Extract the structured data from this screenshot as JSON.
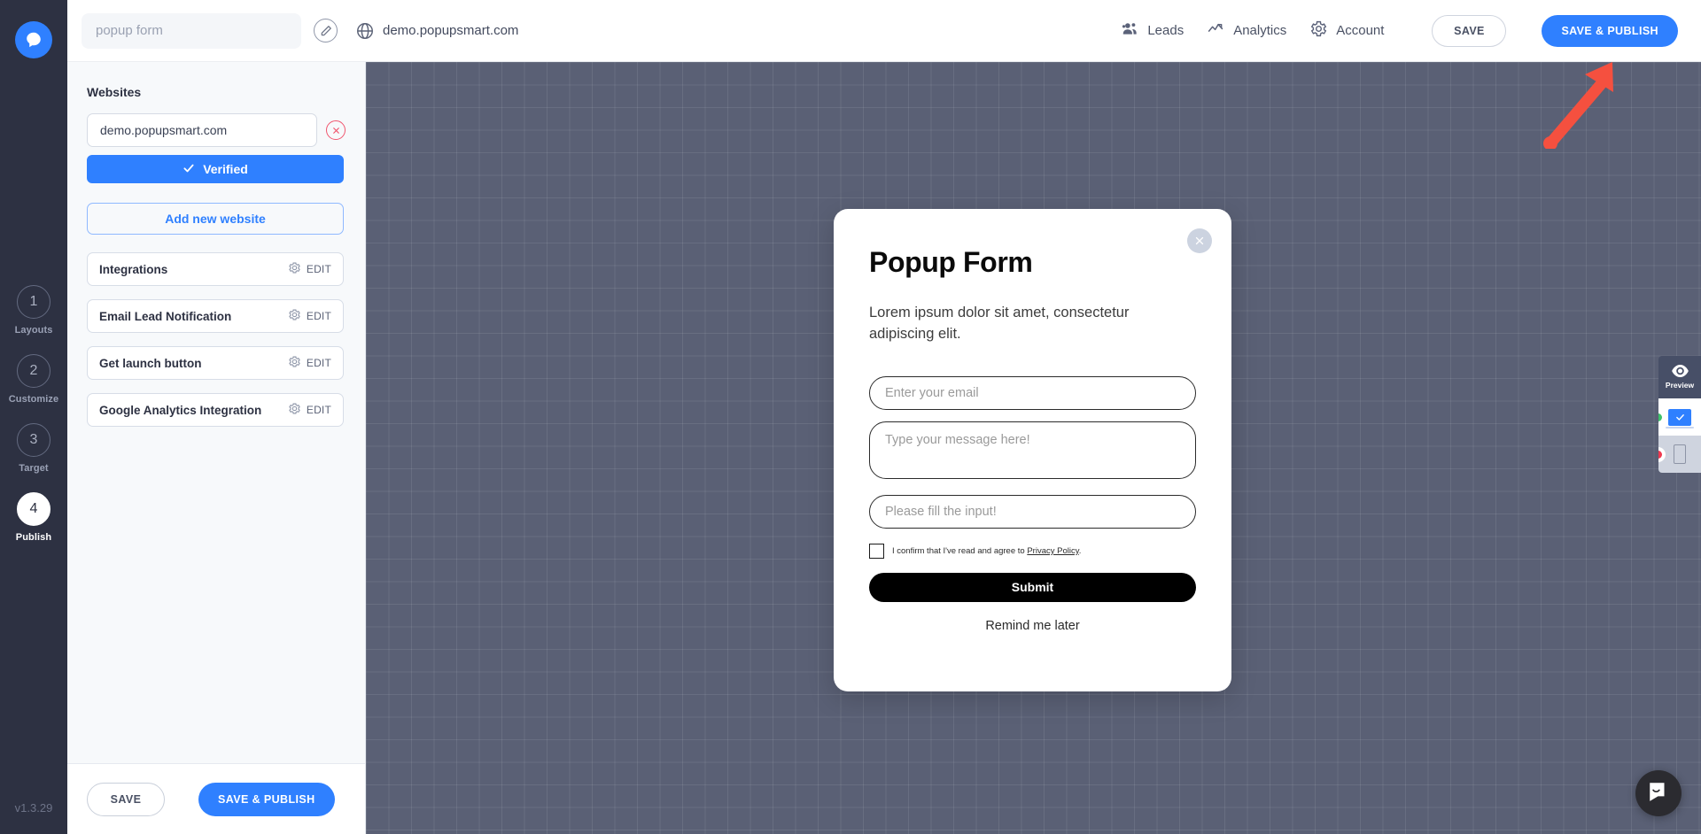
{
  "brand": {
    "logo_icon": "popupsmart-logo-icon",
    "version": "v1.3.29"
  },
  "topbar": {
    "campaign_name_placeholder": "popup form",
    "campaign_name_value": "",
    "edit_icon": "pencil-edit-icon",
    "globe_icon": "globe-icon",
    "domain": "demo.popupsmart.com",
    "nav": [
      {
        "label": "Leads",
        "icon": "people-icon"
      },
      {
        "label": "Analytics",
        "icon": "analytics-chart-icon"
      },
      {
        "label": "Account",
        "icon": "gear-icon"
      }
    ],
    "save_label": "SAVE",
    "save_publish_label": "SAVE & PUBLISH"
  },
  "steps": [
    {
      "number": "1",
      "label": "Layouts",
      "active": false
    },
    {
      "number": "2",
      "label": "Customize",
      "active": false
    },
    {
      "number": "3",
      "label": "Target",
      "active": false
    },
    {
      "number": "4",
      "label": "Publish",
      "active": true
    }
  ],
  "panel": {
    "heading": "Websites",
    "website_value": "demo.popupsmart.com",
    "remove_icon": "close-circle-icon",
    "verified_label": "Verified",
    "verified_icon": "check-icon",
    "add_website_label": "Add new website",
    "options": [
      {
        "label": "Integrations",
        "edit_label": "EDIT",
        "icon": "gear-icon"
      },
      {
        "label": "Email Lead Notification",
        "edit_label": "EDIT",
        "icon": "gear-icon"
      },
      {
        "label": "Get launch button",
        "edit_label": "EDIT",
        "icon": "gear-icon"
      },
      {
        "label": "Google Analytics Integration",
        "edit_label": "EDIT",
        "icon": "gear-icon"
      }
    ],
    "footer_save_label": "SAVE",
    "footer_publish_label": "SAVE & PUBLISH"
  },
  "popup": {
    "close_icon": "close-x-icon",
    "title": "Popup Form",
    "description": "Lorem ipsum dolor sit amet, consectetur adipiscing elit.",
    "email_placeholder": "Enter your email",
    "message_placeholder": "Type your message here!",
    "extra_placeholder": "Please fill the input!",
    "consent_prefix": "I confirm that I've read and agree to ",
    "consent_link": "Privacy Policy",
    "consent_suffix": ".",
    "submit_label": "Submit",
    "remind_label": "Remind me later"
  },
  "devtools": {
    "preview_label": "Preview",
    "preview_icon": "eye-icon",
    "desktop_icon": "monitor-icon",
    "mobile_icon": "phone-icon",
    "desktop_status_color": "#3ec16a",
    "mobile_status_color": "#f0384f"
  },
  "support": {
    "icon": "chat-bubble-icon"
  },
  "annotation": {
    "arrow_color": "#f5503f"
  },
  "colors": {
    "accent_blue": "#2f80ff",
    "rail_dark": "#2d3142",
    "canvas_gray": "#5a6075",
    "danger_red": "#f0566e"
  }
}
